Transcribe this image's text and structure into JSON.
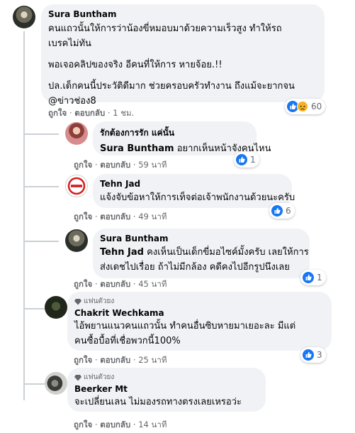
{
  "comments": [
    {
      "author": "Sura Buntham",
      "lines": [
        "คนแถวนั้นให้การว่าน้องขี่หมอบมาด้วยความเร็วสูง ทำให้รถ",
        "เบรคไม่ทัน",
        "พอเจอคลิปของจริง อีคนที่ให้การ หายจ้อย.!!",
        "ปล.เด็กคนนี้ประวัติดีมาก ช่วยครอบครัวทำงาน ถึงแม้จะยากจน",
        "@ข่าวช่อง8"
      ],
      "like": "ถูกใจ",
      "reply": "ตอบกลับ",
      "time": "1 ชม.",
      "reactions": "60"
    },
    {
      "author": "รักต้องการรัก แค่นั้น",
      "mention": "Sura Buntham",
      "text": "อยากเห็นหน้าจังคนไหน",
      "like": "ถูกใจ",
      "reply": "ตอบกลับ",
      "time": "59 นาที",
      "reactions": "1"
    },
    {
      "author": "Tehn Jad",
      "text": "แจ้งจับข้อหาให้การเท็จต่อเจ้าพนักงานด้วยนะครับ",
      "like": "ถูกใจ",
      "reply": "ตอบกลับ",
      "time": "49 นาที",
      "reactions": "6"
    },
    {
      "author": "Sura Buntham",
      "mention": "Tehn Jad",
      "lines": [
        "คงเห็นเป็นเด็กขี่มอไซค์มั้งครับ เลยให้การ",
        "ส่งเดชไปเรื่อย ถ้าไม่มีกล้อง คดีคงไปอีกรูปนึงเลย"
      ],
      "like": "ถูกใจ",
      "reply": "ตอบกลับ",
      "time": "45 นาที",
      "reactions": "1"
    },
    {
      "badge": "แฟนตัวยง",
      "author": "Chakrit Wechkama",
      "lines": [
        "ไอ้พยานแนวคนแถวนั้น ทำคนอื่นซิบหายมาเยอะละ มีแต่",
        "คนซื้อบื้อที่เชื่อพวกนี้100%"
      ],
      "like": "ถูกใจ",
      "reply": "ตอบกลับ",
      "time": "25 นาที",
      "reactions": "3"
    },
    {
      "badge": "แฟนตัวยง",
      "author": "Beerker Mt",
      "text": "จะเปลี่ยนเลน ไม่มองรถทางตรงเลยเหรอว่ะ",
      "like": "ถูกใจ",
      "reply": "ตอบกลับ",
      "time": "14 นาที"
    }
  ],
  "separator": "·",
  "colors": {
    "bubble": "#f0f2f5",
    "meta": "#65676b",
    "like_blue": "#1877f2",
    "sad_yellow": "#f7b125",
    "thread_line": "#ccd0d5"
  },
  "icons": {
    "like": "thumbs-up-icon",
    "sad": "sad-face-icon",
    "badge": "diamond-icon"
  }
}
